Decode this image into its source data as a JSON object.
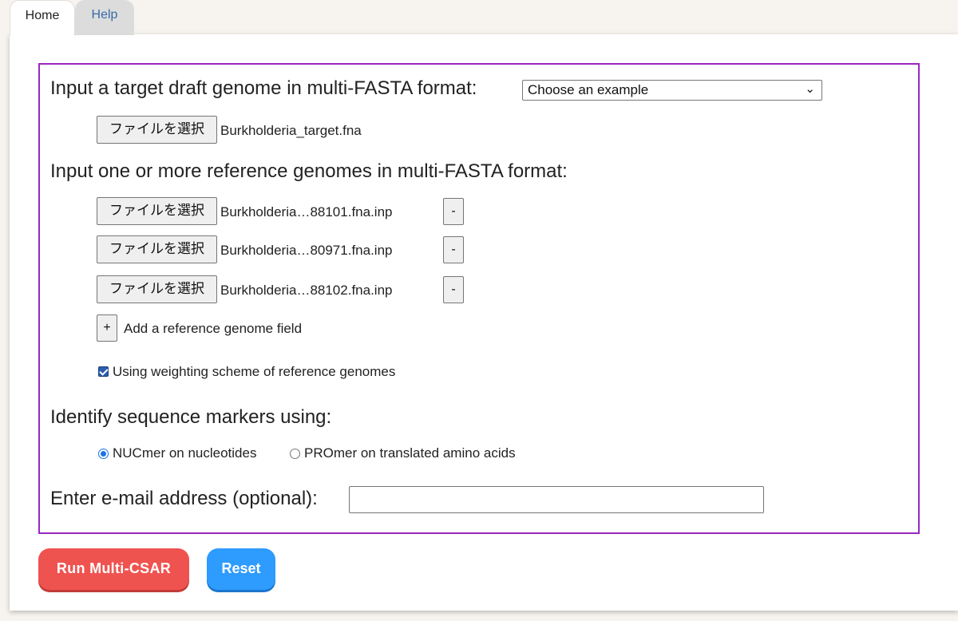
{
  "tabs": [
    {
      "label": "Home",
      "active": true
    },
    {
      "label": "Help",
      "active": false
    }
  ],
  "form": {
    "target_heading": "Input a target draft genome in multi-FASTA format:",
    "example_select": {
      "value": "Choose an example"
    },
    "choose_file_label": "ファイルを選択",
    "target_file": "Burkholderia_target.fna",
    "reference_heading": "Input one or more reference genomes in multi-FASTA format:",
    "reference_files": [
      {
        "name": "Burkholderia…88101.fna.inp",
        "remove_label": "-"
      },
      {
        "name": "Burkholderia…80971.fna.inp",
        "remove_label": "-"
      },
      {
        "name": "Burkholderia…88102.fna.inp",
        "remove_label": "-"
      }
    ],
    "add_reference": {
      "button": "+",
      "label": "Add a reference genome field"
    },
    "weighting": {
      "label": "Using weighting scheme of reference genomes",
      "checked": true
    },
    "marker_heading": "Identify sequence markers using:",
    "marker_options": [
      {
        "label": "NUCmer on nucleotides",
        "selected": true
      },
      {
        "label": "PROmer on translated amino acids",
        "selected": false
      }
    ],
    "email_label": "Enter e-mail address (optional):",
    "email_value": ""
  },
  "actions": {
    "run_label": "Run Multi-CSAR",
    "reset_label": "Reset"
  },
  "colors": {
    "form_border": "#9b27c0",
    "run_button": "#ef5350",
    "reset_button": "#2e9bff",
    "help_tab_text": "#3a6aa8"
  },
  "icons": {
    "select_chevron": "chevron-down-icon"
  }
}
